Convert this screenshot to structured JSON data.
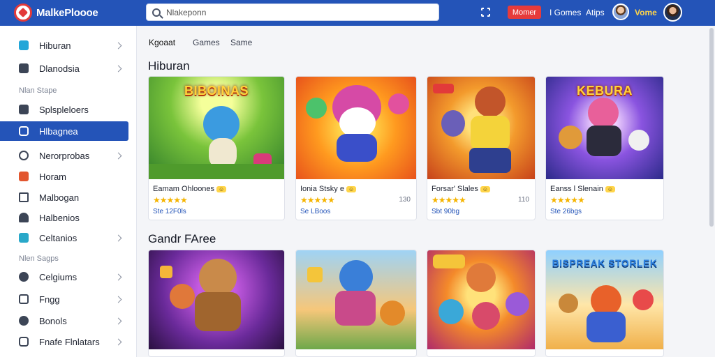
{
  "app": {
    "logo_text": "MalkePloooe"
  },
  "search": {
    "value": "Nlakeponn",
    "placeholder": ""
  },
  "topnav": {
    "red_button": "Momer",
    "link1": "I Gomes",
    "link2": "Atips",
    "user_name": "Vome"
  },
  "sidebar": {
    "items": [
      {
        "label": "Hiburan"
      },
      {
        "label": "Dlanodsia"
      },
      {
        "label": "Splspleloers"
      },
      {
        "label": "Hlbagnea"
      },
      {
        "label": "Nerorprobas"
      },
      {
        "label": "Horam"
      },
      {
        "label": "Malbogan"
      },
      {
        "label": "Halbenios"
      },
      {
        "label": "Celtanios"
      },
      {
        "label": "Celgiums"
      },
      {
        "label": "Fngg"
      },
      {
        "label": "Bonols"
      },
      {
        "label": "Fnafe Flnlatars"
      }
    ],
    "section1": "Nlan  Stape",
    "section2": "Nlen  Sagps"
  },
  "tabs": {
    "t1": "Kgoaat",
    "t2": "Games",
    "t3": "Same"
  },
  "section1": {
    "title": "Hiburan",
    "cards": [
      {
        "thumb_title": "BIBOINAS",
        "name": "Eamam Ohloones",
        "badge": "☺",
        "meta": "",
        "sub": "Ste 12F0ls"
      },
      {
        "thumb_title": "",
        "name": "Ionia Stsky e",
        "badge": "☺",
        "meta": "130",
        "sub": "Se LBoos"
      },
      {
        "thumb_title": "",
        "name": "Forsar' Slales",
        "badge": "☺",
        "meta": "110",
        "sub": "Sbt 90bg"
      },
      {
        "thumb_title": "KEBURA",
        "name": "Eanss l Slenain",
        "badge": "☺",
        "meta": "",
        "sub": "Ste 26bgs"
      }
    ]
  },
  "section2": {
    "title": "Gandr FAree",
    "cards": [
      {
        "thumb_title": ""
      },
      {
        "thumb_title": ""
      },
      {
        "thumb_title": ""
      },
      {
        "thumb_title": "BISPREAK STORLEK"
      }
    ]
  },
  "colors": {
    "topbar": "#2454b8",
    "accent_red": "#e63b3b",
    "star": "#f5b400"
  }
}
